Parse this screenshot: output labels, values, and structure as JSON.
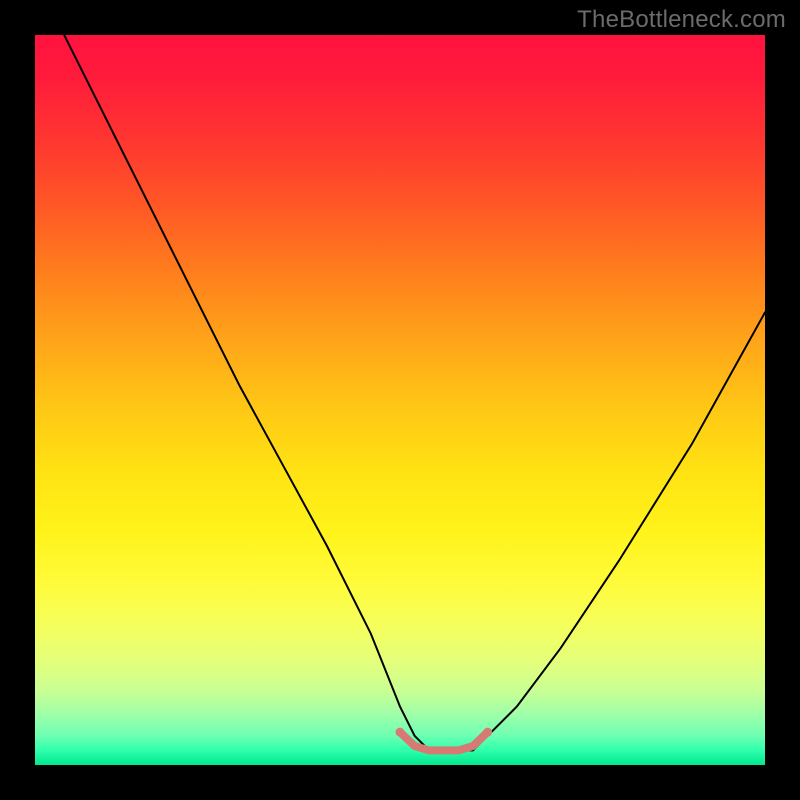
{
  "watermark": "TheBottleneck.com",
  "chart_data": {
    "type": "line",
    "title": "",
    "xlabel": "",
    "ylabel": "",
    "xlim": [
      0,
      100
    ],
    "ylim": [
      0,
      100
    ],
    "grid": false,
    "legend": false,
    "background_gradient": {
      "orientation": "vertical",
      "stops": [
        {
          "pos": 0.0,
          "color": "#ff123f"
        },
        {
          "pos": 0.25,
          "color": "#ff6a20"
        },
        {
          "pos": 0.5,
          "color": "#ffc715"
        },
        {
          "pos": 0.7,
          "color": "#fffb3a"
        },
        {
          "pos": 0.85,
          "color": "#d8ff86"
        },
        {
          "pos": 1.0,
          "color": "#00e88c"
        }
      ]
    },
    "series": [
      {
        "name": "bottleneck-curve",
        "color": "#000000",
        "stroke_width": 2,
        "x": [
          4,
          10,
          16,
          22,
          28,
          34,
          40,
          46,
          50,
          52,
          54,
          56,
          58,
          60,
          62,
          66,
          72,
          80,
          90,
          100
        ],
        "y": [
          100,
          88,
          76,
          64,
          52,
          41,
          30,
          18,
          8,
          4,
          2,
          2,
          2,
          2,
          4,
          8,
          16,
          28,
          44,
          62
        ]
      },
      {
        "name": "optimal-zone-highlight",
        "color": "#d77a73",
        "stroke_width": 8,
        "x": [
          50,
          52,
          54,
          56,
          58,
          60,
          62
        ],
        "y": [
          4.5,
          2.6,
          2.0,
          2.0,
          2.0,
          2.6,
          4.5
        ]
      }
    ],
    "annotations": []
  }
}
